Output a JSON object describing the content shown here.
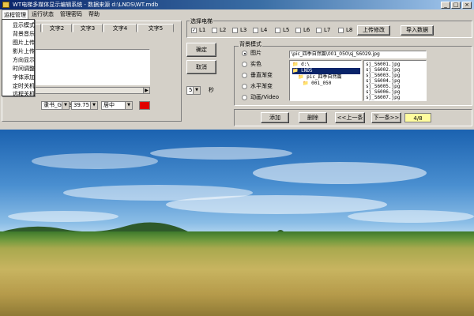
{
  "window": {
    "title": "WT电梯多媒体显示编辑系统 - 数据来源 d:\\LNDS\\WT.mdb",
    "minimize": "_",
    "maximize": "□",
    "close": "×"
  },
  "menu": {
    "items": [
      "运程管理",
      "运行状态",
      "管理密码",
      "帮助"
    ],
    "dropdown": [
      "显示模式",
      "背景音乐",
      "图片上传",
      "影片上传",
      "方向显示",
      "时间调整",
      "字体添加",
      "定时关机",
      "远程关机"
    ]
  },
  "text_tabs": [
    "文字1",
    "文字2",
    "文字3",
    "文字4",
    "文字5"
  ],
  "font_row": {
    "font": "隶书_GB2312",
    "size": "39.75",
    "align": "居中",
    "color": "#e00000"
  },
  "confirm_label": "确定",
  "cancel_label": "取消",
  "seconds": {
    "value": "5",
    "unit": "秒"
  },
  "elevators": {
    "title": "选择电梯",
    "items": [
      {
        "label": "L1",
        "checked": true
      },
      {
        "label": "L2",
        "checked": false
      },
      {
        "label": "L3",
        "checked": false
      },
      {
        "label": "L4",
        "checked": false
      },
      {
        "label": "L5",
        "checked": false
      },
      {
        "label": "L6",
        "checked": false
      },
      {
        "label": "L7",
        "checked": false
      },
      {
        "label": "L8",
        "checked": false
      }
    ],
    "upload_label": "上传修改",
    "import_label": "导入数据"
  },
  "background": {
    "title": "背景模式",
    "modes": [
      {
        "label": "图片",
        "selected": true
      },
      {
        "label": "实色",
        "selected": false
      },
      {
        "label": "垂直渐变",
        "selected": false
      },
      {
        "label": "水平渐变",
        "selected": false
      },
      {
        "label": "动画/Video",
        "selected": false
      }
    ],
    "path": "\\pic_四季自然篇\\001_050\\sj_S6029.jpg",
    "tree": [
      "d:\\",
      "LNDS",
      "pic_四季自然篇",
      "001_050"
    ],
    "files": [
      "sj_S6001.jpg",
      "sj_S6002.jpg",
      "sj_S6003.jpg",
      "sj_S6004.jpg",
      "sj_S6005.jpg",
      "sj_S6006.jpg",
      "sj_S6007.jpg"
    ]
  },
  "nav": {
    "add": "添加",
    "delete": "删除",
    "prev": "<<上一条",
    "next": "下一条>>",
    "counter": "4/8"
  }
}
